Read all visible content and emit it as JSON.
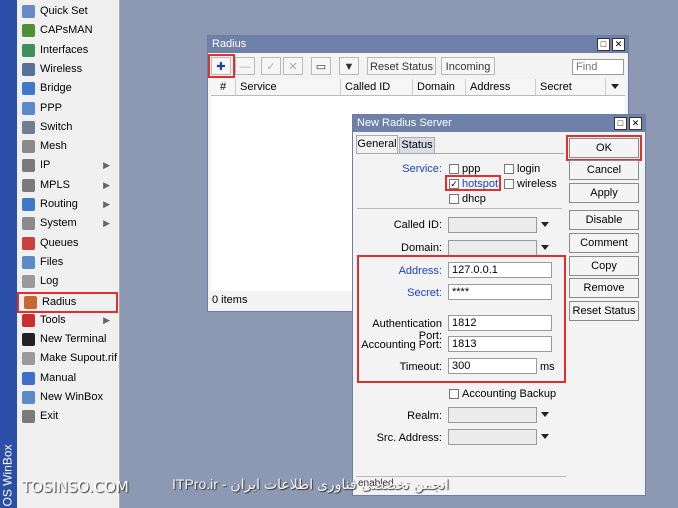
{
  "sidebar": {
    "vertical_label": "OS WinBox",
    "items": [
      {
        "label": "Quick Set",
        "icon": "quick-set-icon",
        "color": "#6a87c8",
        "arrow": false
      },
      {
        "label": "CAPsMAN",
        "icon": "capsman-icon",
        "color": "#4f8f3a",
        "arrow": false
      },
      {
        "label": "Interfaces",
        "icon": "interfaces-icon",
        "color": "#3f8f5a",
        "arrow": false
      },
      {
        "label": "Wireless",
        "icon": "wireless-icon",
        "color": "#5a6f9a",
        "arrow": false
      },
      {
        "label": "Bridge",
        "icon": "bridge-icon",
        "color": "#3f78c8",
        "arrow": false
      },
      {
        "label": "PPP",
        "icon": "ppp-icon",
        "color": "#5a8ac8",
        "arrow": false
      },
      {
        "label": "Switch",
        "icon": "switch-icon",
        "color": "#6f7f8f",
        "arrow": false
      },
      {
        "label": "Mesh",
        "icon": "mesh-icon",
        "color": "#8a8a8a",
        "arrow": false
      },
      {
        "label": "IP",
        "icon": "ip-icon",
        "color": "#7a7a7a",
        "arrow": true
      },
      {
        "label": "MPLS",
        "icon": "mpls-icon",
        "color": "#7a7a7a",
        "arrow": true
      },
      {
        "label": "Routing",
        "icon": "routing-icon",
        "color": "#3f78c8",
        "arrow": true
      },
      {
        "label": "System",
        "icon": "system-icon",
        "color": "#8a8a8a",
        "arrow": true
      },
      {
        "label": "Queues",
        "icon": "queues-icon",
        "color": "#c84040",
        "arrow": false
      },
      {
        "label": "Files",
        "icon": "files-icon",
        "color": "#5a8ac8",
        "arrow": false
      },
      {
        "label": "Log",
        "icon": "log-icon",
        "color": "#9a9a9a",
        "arrow": false
      },
      {
        "label": "Radius",
        "icon": "radius-icon",
        "color": "#c86a30",
        "arrow": false,
        "selected": true
      },
      {
        "label": "Tools",
        "icon": "tools-icon",
        "color": "#c83030",
        "arrow": true
      },
      {
        "label": "New Terminal",
        "icon": "terminal-icon",
        "color": "#222222",
        "arrow": false
      },
      {
        "label": "Make Supout.rif",
        "icon": "supout-icon",
        "color": "#9a9a9a",
        "arrow": false
      },
      {
        "label": "Manual",
        "icon": "manual-icon",
        "color": "#3f6fc8",
        "arrow": false
      },
      {
        "label": "New WinBox",
        "icon": "winbox-icon",
        "color": "#5a8ac8",
        "arrow": false
      },
      {
        "label": "Exit",
        "icon": "exit-icon",
        "color": "#7a7a7a",
        "arrow": false
      }
    ]
  },
  "radius_window": {
    "title": "Radius",
    "toolbar": {
      "add": "✚",
      "remove": "—",
      "enable": "✓",
      "disable": "✕",
      "comment": "▭",
      "filter": "▼",
      "reset_status": "Reset Status",
      "incoming": "Incoming",
      "find_placeholder": "Find"
    },
    "columns": [
      "#",
      "Service",
      "Called ID",
      "Domain",
      "Address",
      "Secret"
    ],
    "status": "0 items"
  },
  "dialog": {
    "title": "New Radius Server",
    "tabs": [
      "General",
      "Status"
    ],
    "service_label": "Service:",
    "services": [
      {
        "label": "ppp",
        "checked": false
      },
      {
        "label": "login",
        "checked": false
      },
      {
        "label": "hotspot",
        "checked": true
      },
      {
        "label": "wireless",
        "checked": false
      },
      {
        "label": "dhcp",
        "checked": false
      }
    ],
    "called_id_label": "Called ID:",
    "domain_label": "Domain:",
    "address_label": "Address:",
    "address_value": "127.0.0.1",
    "secret_label": "Secret:",
    "secret_value": "****",
    "auth_port_label": "Authentication Port:",
    "auth_port_value": "1812",
    "acct_port_label": "Accounting Port:",
    "acct_port_value": "1813",
    "timeout_label": "Timeout:",
    "timeout_value": "300",
    "timeout_unit": "ms",
    "accounting_backup_label": "Accounting Backup",
    "realm_label": "Realm:",
    "src_address_label": "Src. Address:",
    "status_text": "enabled",
    "buttons": [
      "OK",
      "Cancel",
      "Apply",
      "Disable",
      "Comment",
      "Copy",
      "Remove",
      "Reset Status"
    ]
  },
  "watermark": {
    "left": "TOSINSO.COM",
    "right": "انجمن تخصصی فناوری اطلاعات ایران - ITPro.ir"
  },
  "accent_red": "#e0302e",
  "title_bar_color": "#6f80a9"
}
